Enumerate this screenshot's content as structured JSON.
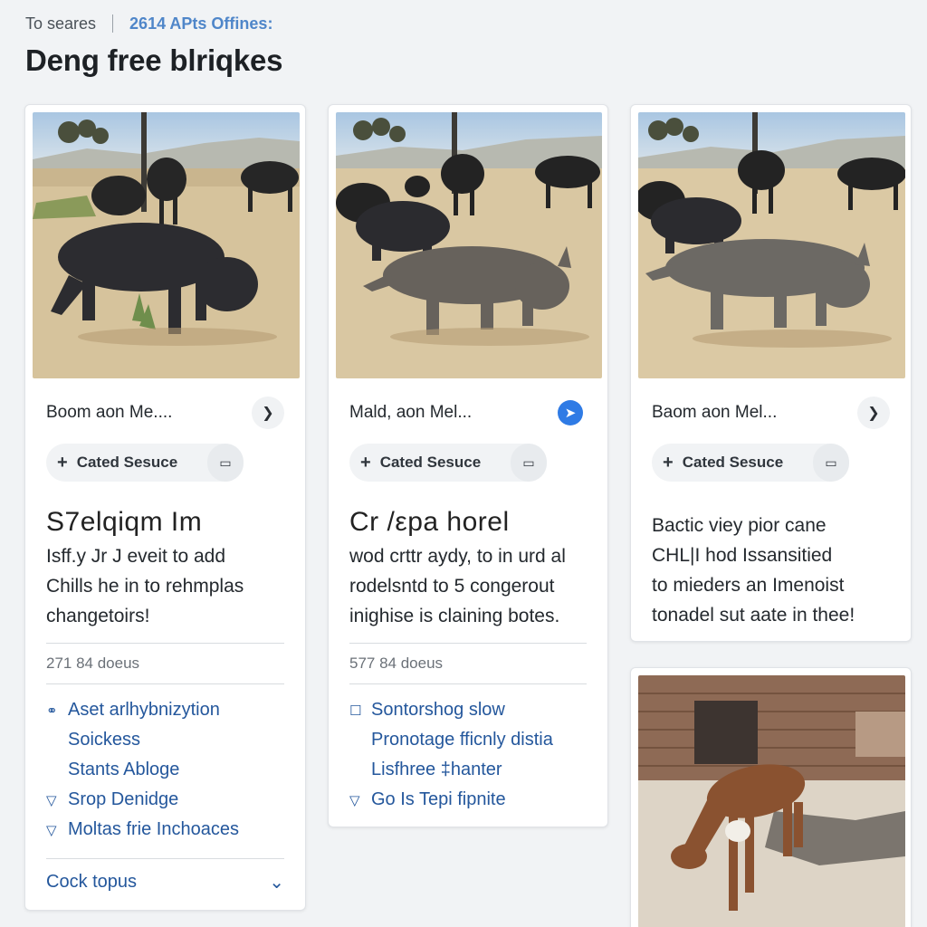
{
  "breadcrumb": {
    "home": "To seares",
    "current": "2614 APts Offines:"
  },
  "page_title": "Deng free blriqkes",
  "cards": [
    {
      "author": "Boom aon Me....",
      "action_icon": "chevron-right-icon",
      "pill_label": "Cated Sesuce",
      "headline": "S7elqiqm Im",
      "desc": [
        "Isff.y Jr J eveit to add",
        "Chills he in to rehmplas",
        "changetoirs!"
      ],
      "count": "271 84 doeus",
      "links": [
        {
          "icon": "link-icon",
          "label": "Aset arlhybnizytion"
        },
        {
          "icon": "",
          "label": "Soickess"
        },
        {
          "icon": "",
          "label": "Stants Abloge"
        },
        {
          "icon": "chevron-down-icon",
          "label": "Srop Denidge"
        },
        {
          "icon": "chevron-down-icon",
          "label": "Moltas frie Inchoaces"
        }
      ],
      "footer": "Cock topus"
    },
    {
      "author": "Mald, aon Mel...",
      "action_icon": "arrow-up-icon",
      "pill_label": "Cated Sesuce",
      "headline": "Cr /εpa horel",
      "desc": [
        "wod crttr aydy, to in urd al",
        "rodelsntd to 5 congerout",
        "inighise is claining botes."
      ],
      "count": "577 84 doeus",
      "links": [
        {
          "icon": "checkbox-icon",
          "label": "Sontorshog slow"
        },
        {
          "icon": "",
          "label": "Pronotage fficnly distia"
        },
        {
          "icon": "",
          "label": "Lisfhree ‡hanter"
        },
        {
          "icon": "chevron-down-icon",
          "label": "Go Is Tepi fipnite"
        }
      ]
    },
    {
      "author": "Baom aon Mel...",
      "action_icon": "chevron-right-icon",
      "pill_label": "Cated Sesuce",
      "desc": [
        "Bactic viey pior cane",
        "CHL|I hod Issansitied",
        "to mieders an Imenoist",
        "tonadel sut aate in thee!"
      ]
    }
  ],
  "colors": {
    "accent": "#2f7be5",
    "link": "#24579c",
    "breadcrumb_current": "#4f86c9"
  }
}
